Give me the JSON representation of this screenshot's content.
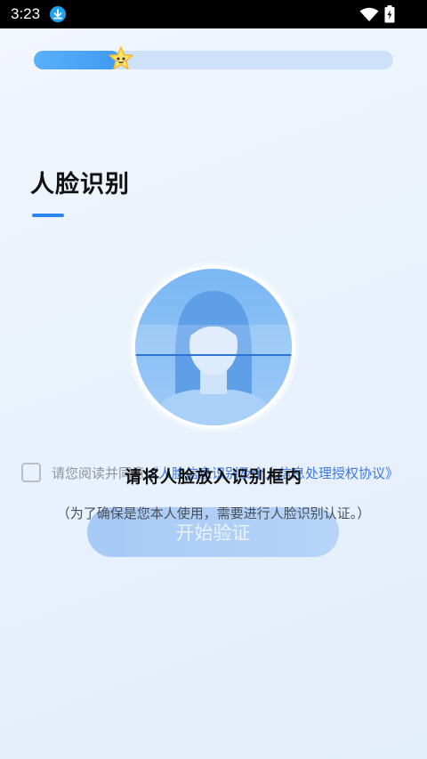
{
  "status_bar": {
    "time": "3:23"
  },
  "progress": {
    "fraction": 0.24
  },
  "header": {
    "title": "人脸识别"
  },
  "consent": {
    "prefix": "请您阅读并同意",
    "link": "《人脸信息识别及个人信息处理授权协议》"
  },
  "actions": {
    "start_label": "开始验证"
  },
  "face_overlay": {
    "instruction": "请将人脸放入识别框内",
    "subtext": "（为了确保是您本人使用，需要进行人脸识别认证。）"
  },
  "colors": {
    "accent": "#2b86f0",
    "link": "#3d7ae6",
    "button_disabled": "#a6c9f6"
  }
}
